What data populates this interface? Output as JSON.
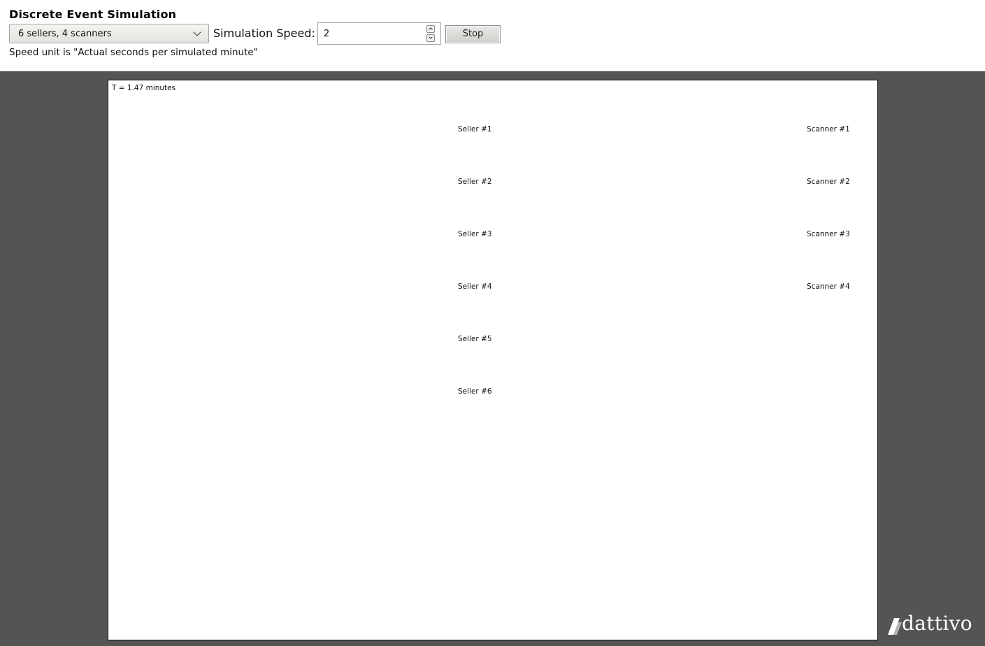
{
  "header": {
    "title": "Discrete Event Simulation",
    "config_select": {
      "selected": "6 sellers, 4 scanners"
    },
    "speed_label": "Simulation Speed:",
    "speed_value": "2",
    "stop_label": "Stop",
    "speed_note": "Speed unit is \"Actual seconds per simulated minute\""
  },
  "simulation": {
    "time_readout": "T = 1.47 minutes",
    "sellers": [
      "Seller #1",
      "Seller #2",
      "Seller #3",
      "Seller #4",
      "Seller #5",
      "Seller #6"
    ],
    "scanners": [
      "Scanner #1",
      "Scanner #2",
      "Scanner #3",
      "Scanner #4"
    ]
  },
  "branding": {
    "logo_text": "dattivo"
  },
  "colors": {
    "stage_background": "#545452",
    "canvas_background": "#fffffd"
  }
}
